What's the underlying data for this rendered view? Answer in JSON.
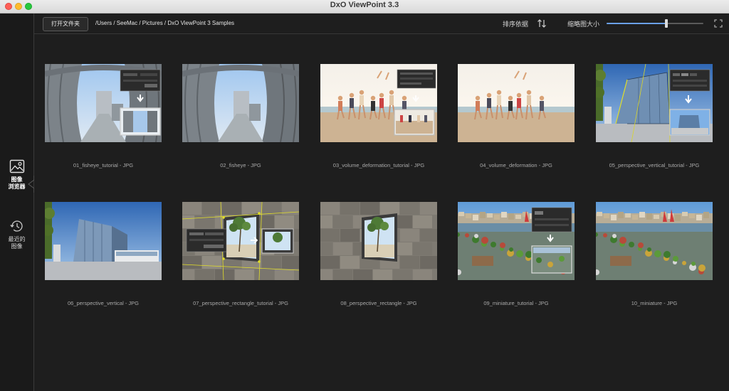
{
  "window": {
    "title": "DxO ViewPoint 3.3"
  },
  "sidebar": {
    "items": [
      {
        "label_line1": "图像",
        "label_line2": "浏览器",
        "icon": "image-icon",
        "active": true
      },
      {
        "label_line1": "最近的",
        "label_line2": "图像",
        "icon": "clock-icon",
        "active": false
      }
    ]
  },
  "toolbar": {
    "open_folder_label": "打开文件夹",
    "path": "/Users / SeeMac / Pictures / DxO ViewPoint 3 Samples",
    "sort_label": "排序依据",
    "thumbnail_size_label": "缩略图大小",
    "thumbnail_size_value": 0.62
  },
  "images": [
    {
      "caption": "01_fisheye_tutorial - JPG",
      "scene": "fisheye",
      "tutorial": true
    },
    {
      "caption": "02_fisheye - JPG",
      "scene": "fisheye",
      "tutorial": false
    },
    {
      "caption": "03_volume_deformation_tutorial - JPG",
      "scene": "beach",
      "tutorial": true
    },
    {
      "caption": "04_volume_deformation - JPG",
      "scene": "beach",
      "tutorial": false
    },
    {
      "caption": "05_perspective_vertical_tutorial - JPG",
      "scene": "building",
      "tutorial": true
    },
    {
      "caption": "06_perspective_vertical - JPG",
      "scene": "building",
      "tutorial": false
    },
    {
      "caption": "07_perspective_rectangle_tutorial - JPG",
      "scene": "wall",
      "tutorial": true
    },
    {
      "caption": "08_perspective_rectangle - JPG",
      "scene": "wall",
      "tutorial": false
    },
    {
      "caption": "09_miniature_tutorial - JPG",
      "scene": "harbor",
      "tutorial": true
    },
    {
      "caption": "10_miniature - JPG",
      "scene": "harbor",
      "tutorial": false
    }
  ],
  "colors": {
    "accent": "#6aa0e8",
    "background": "#1e1e1e",
    "sidebar": "#1a1a1a"
  }
}
